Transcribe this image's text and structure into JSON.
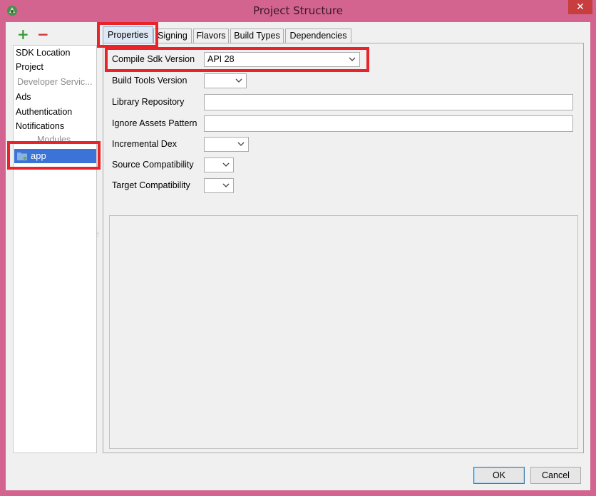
{
  "window": {
    "title": "Project Structure",
    "close_glyph": "✕"
  },
  "toolbar": {
    "add_glyph": "+",
    "remove_glyph": "−"
  },
  "sidebar": {
    "items": [
      {
        "label": "SDK Location"
      },
      {
        "label": "Project"
      },
      {
        "label": "Developer Servic..."
      },
      {
        "label": "Ads"
      },
      {
        "label": "Authentication"
      },
      {
        "label": "Notifications"
      }
    ],
    "modules_header": "Modules",
    "modules": [
      {
        "label": "app",
        "selected": true
      }
    ]
  },
  "tabs": [
    {
      "label": "Properties",
      "active": true
    },
    {
      "label": "Signing"
    },
    {
      "label": "Flavors"
    },
    {
      "label": "Build Types"
    },
    {
      "label": "Dependencies"
    }
  ],
  "properties": {
    "compile_sdk_version": {
      "label": "Compile Sdk Version",
      "value": "API 28"
    },
    "build_tools_version": {
      "label": "Build Tools Version",
      "value": ""
    },
    "library_repository": {
      "label": "Library Repository",
      "value": ""
    },
    "ignore_assets_pattern": {
      "label": "Ignore Assets Pattern",
      "value": ""
    },
    "incremental_dex": {
      "label": "Incremental Dex",
      "value": ""
    },
    "source_compatibility": {
      "label": "Source Compatibility",
      "value": ""
    },
    "target_compatibility": {
      "label": "Target Compatibility",
      "value": ""
    }
  },
  "buttons": {
    "ok": "OK",
    "cancel": "Cancel"
  },
  "colors": {
    "window_frame": "#d2648f",
    "selection": "#3b74d6",
    "highlight_annotation": "#e8242a",
    "add": "#3a9b3a",
    "remove": "#d23333"
  }
}
